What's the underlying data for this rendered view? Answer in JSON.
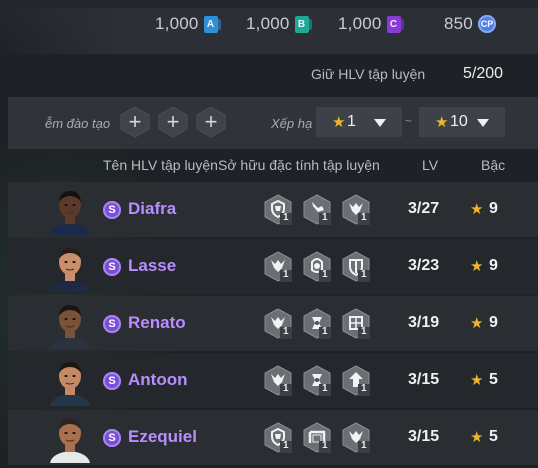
{
  "currencies": [
    {
      "name": "A-token",
      "value": "1,000",
      "icon": "a-card-icon",
      "letter": "A",
      "color": "#2f8fd8"
    },
    {
      "name": "B-token",
      "value": "1,000",
      "icon": "b-card-icon",
      "letter": "B",
      "color": "#1fa79a"
    },
    {
      "name": "C-token",
      "value": "1,000",
      "icon": "c-card-icon",
      "letter": "C",
      "color": "#8a3ad6"
    },
    {
      "name": "coin",
      "value": "850",
      "icon": "coin-icon",
      "letter": "CP",
      "color": "#4f7ee6"
    }
  ],
  "capacity": {
    "label": "Giữ HLV tập luyện",
    "value": "5/200"
  },
  "filters": {
    "training_label": "ễm đào tạo",
    "rank_label": "Xếp hạ",
    "rank_from": "1",
    "rank_separator": "~",
    "rank_to": "10",
    "star": "★",
    "plus": "+"
  },
  "headers": {
    "name": "Tên HLV tập luyện",
    "traits": "Sở hữu đặc tính tập luyện",
    "lv": "LV",
    "tier": "Bậc"
  },
  "coaches": [
    {
      "badge": "S",
      "name": "Diafra",
      "lv": "3/27",
      "tier": "9",
      "trait_level": "1",
      "traits": [
        "shield-training-icon",
        "leg-training-icon",
        "tactics-training-icon"
      ]
    },
    {
      "badge": "S",
      "name": "Lasse",
      "lv": "3/23",
      "tier": "9",
      "trait_level": "1",
      "traits": [
        "tactics-training-icon",
        "ball-training-icon",
        "defense-training-icon"
      ]
    },
    {
      "badge": "S",
      "name": "Renato",
      "lv": "3/19",
      "tier": "9",
      "trait_level": "1",
      "traits": [
        "tactics-training-icon",
        "drill-training-icon",
        "grid-training-icon"
      ]
    },
    {
      "badge": "S",
      "name": "Antoon",
      "lv": "3/15",
      "tier": "5",
      "trait_level": "1",
      "traits": [
        "tactics-training-icon",
        "drill-training-icon",
        "arrow-up-training-icon"
      ]
    },
    {
      "badge": "S",
      "name": "Ezequiel",
      "lv": "3/15",
      "tier": "5",
      "trait_level": "1",
      "traits": [
        "shield-training-icon",
        "goal-training-icon",
        "tactics-training-icon"
      ]
    }
  ]
}
